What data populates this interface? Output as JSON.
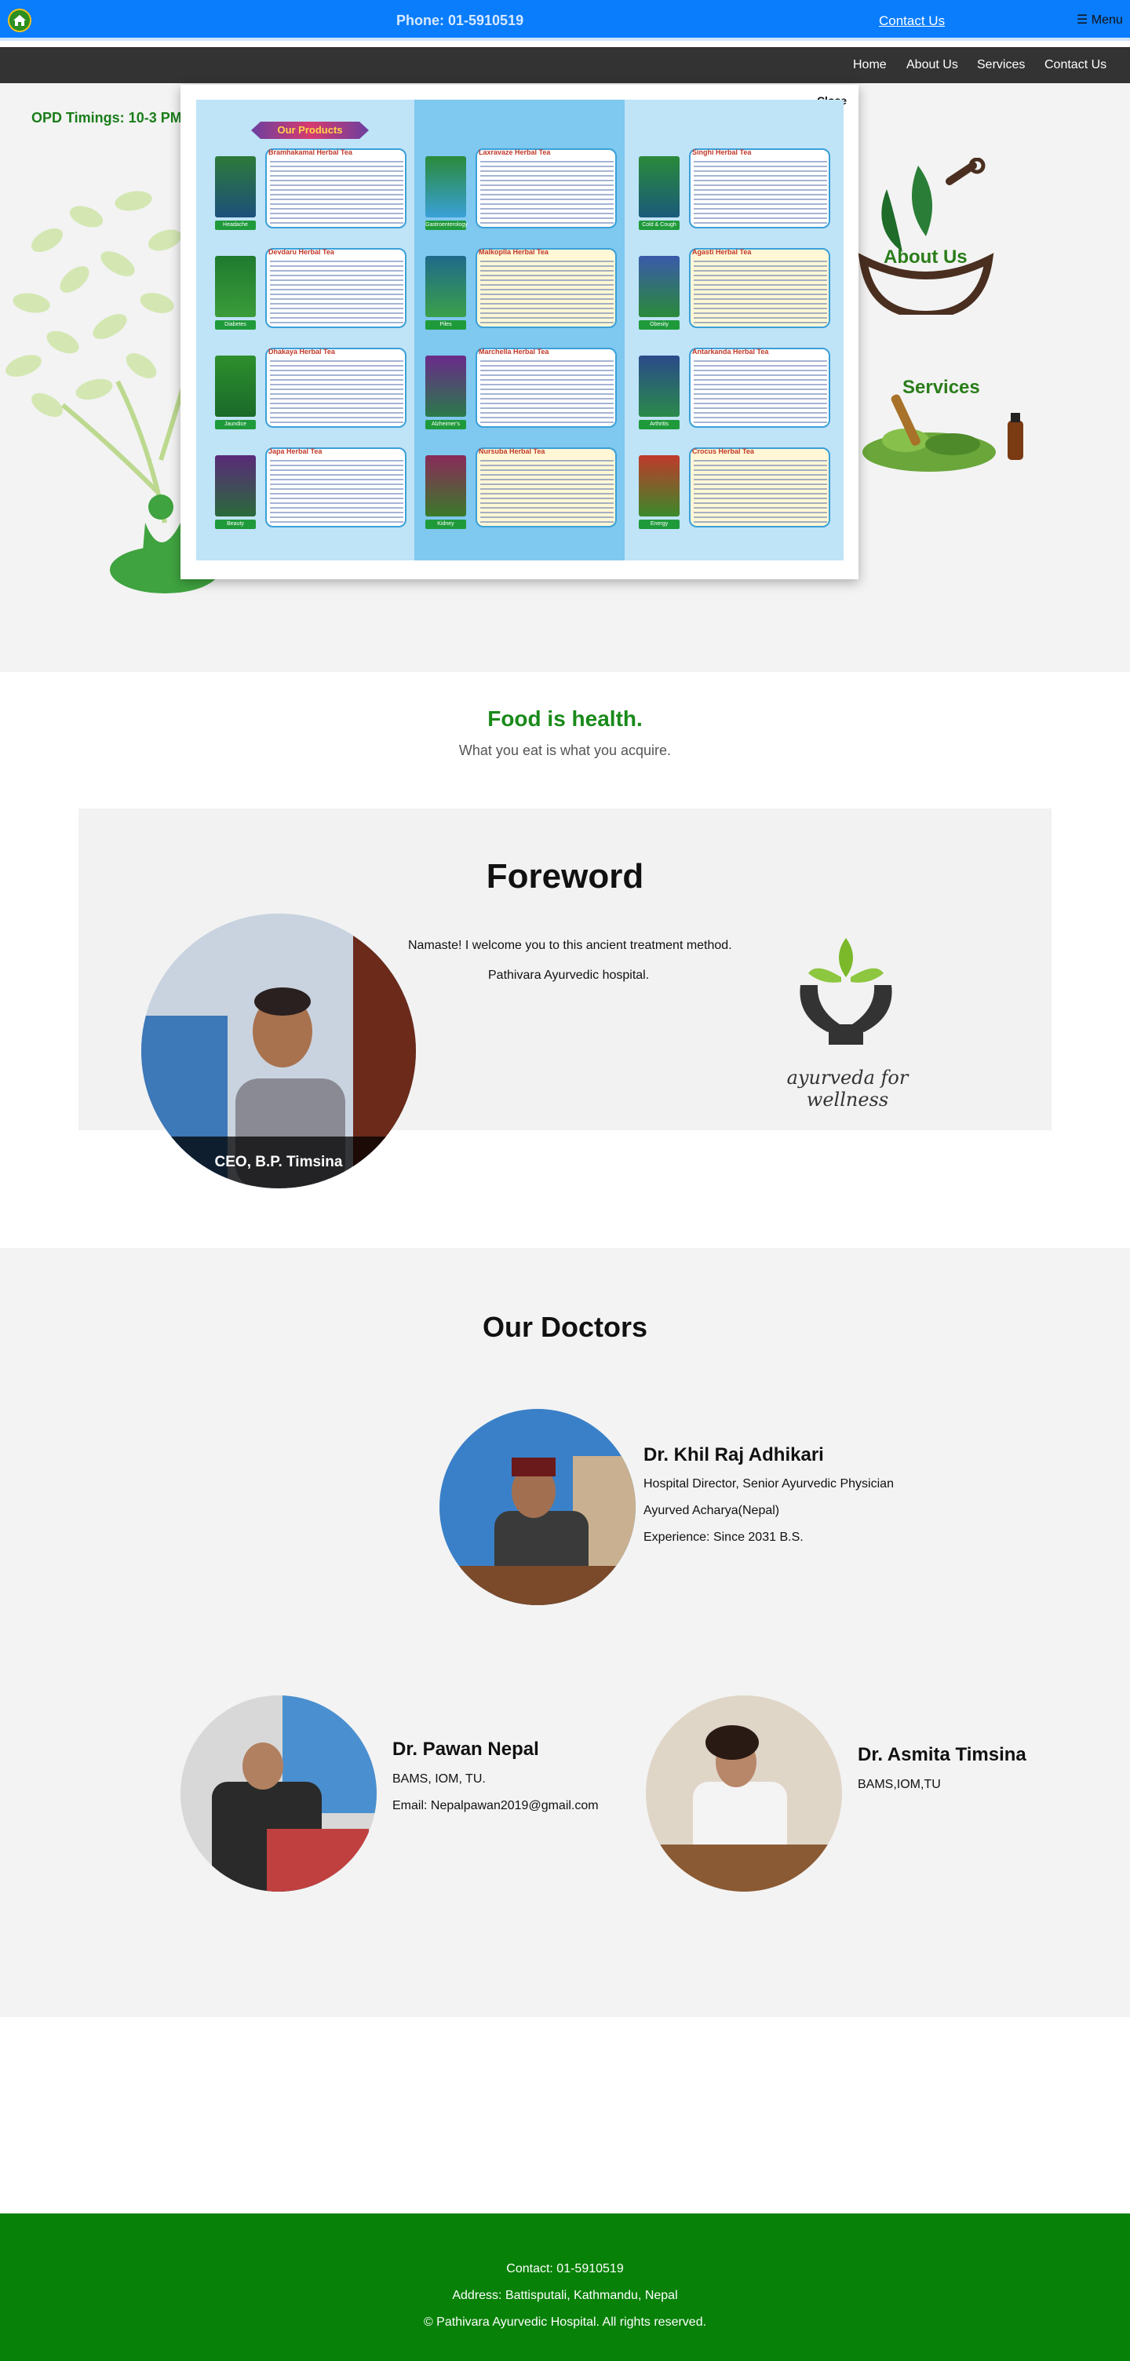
{
  "topbar": {
    "home_icon": "home-icon",
    "phone": "Phone: 01-5910519",
    "contact_link": "Contact Us",
    "menu": "☰ Menu"
  },
  "nav": {
    "items": [
      {
        "label": "Home"
      },
      {
        "label": "About Us"
      },
      {
        "label": "Services"
      },
      {
        "label": "Contact Us"
      }
    ]
  },
  "hero": {
    "opd": "OPD Timings: 10-3 PM",
    "about_label": "About Us",
    "services_label": "Services"
  },
  "modal": {
    "close": "Close",
    "poster_title": "Our Products",
    "products": [
      {
        "name": "Bramhakamal Herbal Tea",
        "tag": "Headache"
      },
      {
        "name": "Devdaru Herbal Tea",
        "tag": "Diabetes"
      },
      {
        "name": "Dhakaya Herbal Tea",
        "tag": "Jaundice"
      },
      {
        "name": "Japa Herbal Tea",
        "tag": "Beauty"
      },
      {
        "name": "Laxravaze Herbal Tea",
        "tag": "Gastroenterology"
      },
      {
        "name": "Malkoplla Herbal Tea",
        "tag": "Piles"
      },
      {
        "name": "Marchella Herbal Tea",
        "tag": "Alzheimer's"
      },
      {
        "name": "Nursuba Herbal Tea",
        "tag": "Kidney"
      },
      {
        "name": "Singhi Herbal Tea",
        "tag": "Cold & Cough"
      },
      {
        "name": "Agasti Herbal Tea",
        "tag": "Obesity"
      },
      {
        "name": "Antarkanda Herbal Tea",
        "tag": "Arthritis"
      },
      {
        "name": "Crocus Herbal Tea",
        "tag": "Energy"
      }
    ]
  },
  "food": {
    "title": "Food is health.",
    "subtitle": "What you eat is what you acquire."
  },
  "foreword": {
    "title": "Foreword",
    "line1": "Namaste! I welcome you to this ancient treatment method.",
    "line2": "Pathivara Ayurvedic hospital.",
    "ceo_caption": "CEO, B.P. Timsina",
    "logo_text": "ayurveda for wellness"
  },
  "doctors": {
    "title": "Our Doctors",
    "list": [
      {
        "name": "Dr. Khil Raj Adhikari",
        "lines": [
          "Hospital Director, Senior Ayurvedic Physician",
          "Ayurved Acharya(Nepal)",
          "Experience: Since 2031 B.S."
        ]
      },
      {
        "name": "Dr. Pawan Nepal",
        "lines": [
          "BAMS, IOM, TU.",
          "Email: Nepalpawan2019@gmail.com"
        ]
      },
      {
        "name": "Dr. Asmita Timsina",
        "lines": [
          "BAMS,IOM,TU"
        ]
      }
    ]
  },
  "footer": {
    "contact": "Contact: 01-5910519",
    "address": "Address: Battisputali, Kathmandu, Nepal",
    "copyright": "© Pathivara Ayurvedic Hospital. All rights reserved."
  },
  "colors": {
    "topbar": "#0a7dfc",
    "navbar": "#333333",
    "accent_green": "#1a8a1a",
    "footer": "#078107"
  }
}
